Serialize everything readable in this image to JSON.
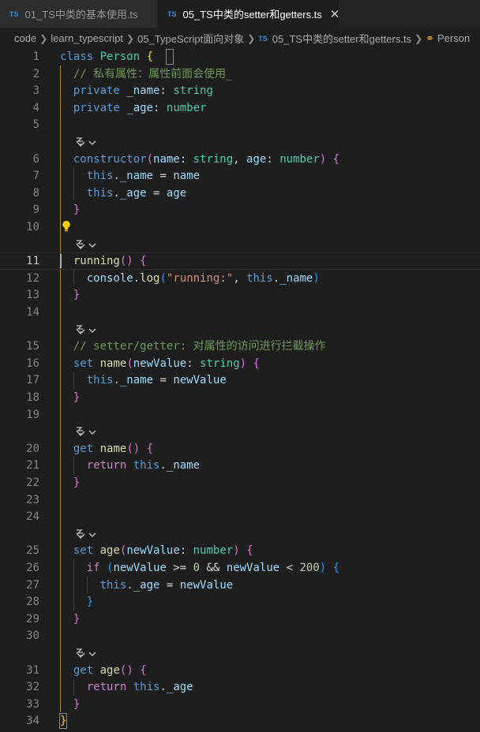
{
  "tabs": [
    {
      "icon": "TS",
      "label": "01_TS中类的基本使用.ts",
      "active": false
    },
    {
      "icon": "TS",
      "label": "05_TS中类的setter和getters.ts",
      "active": true,
      "close": "✕"
    }
  ],
  "breadcrumb": {
    "items": [
      "code",
      "learn_typescript",
      "05_TypeScript面向对象"
    ],
    "file_badge": "TS",
    "file": "05_TS中类的setter和getters.ts",
    "symbol": "Person"
  },
  "lightbulb_icon": "lightbulb-icon",
  "codelens_icon": "copilot-sparkle-icon",
  "line_numbers": [
    "1",
    "2",
    "3",
    "4",
    "5",
    "6",
    "7",
    "8",
    "9",
    "10",
    "11",
    "12",
    "13",
    "14",
    "15",
    "16",
    "17",
    "18",
    "19",
    "20",
    "21",
    "22",
    "23",
    "24",
    "25",
    "26",
    "27",
    "28",
    "29",
    "30",
    "31",
    "32",
    "33",
    "34"
  ],
  "current_line": "11",
  "colors": {
    "keyword": "#569cd6",
    "class": "#4ec9b0",
    "comment": "#6a9955",
    "function": "#dcdcaa",
    "property": "#9cdcfe",
    "string": "#ce9178",
    "number": "#b5cea8",
    "control": "#c586c0",
    "bracket1": "#ffd700",
    "bracket2": "#da70d6",
    "bracket3": "#179fff"
  },
  "code": [
    [
      [
        "class",
        "kw"
      ],
      [
        " ",
        "pu"
      ],
      [
        "Person",
        "cl"
      ],
      [
        " ",
        "pu"
      ],
      [
        "{",
        "b1"
      ]
    ],
    [
      [
        "  ",
        "pu"
      ],
      [
        "// 私有属性：属性前面会使用_",
        "cm"
      ]
    ],
    [
      [
        "  ",
        "pu"
      ],
      [
        "private",
        "kw"
      ],
      [
        " ",
        "pu"
      ],
      [
        "_name",
        "pr"
      ],
      [
        ": ",
        "pu"
      ],
      [
        "string",
        "cl"
      ]
    ],
    [
      [
        "  ",
        "pu"
      ],
      [
        "private",
        "kw"
      ],
      [
        " ",
        "pu"
      ],
      [
        "_age",
        "pr"
      ],
      [
        ": ",
        "pu"
      ],
      [
        "number",
        "cl"
      ]
    ],
    [],
    [
      [
        "  ",
        "pu"
      ],
      [
        "constructor",
        "kw"
      ],
      [
        "(",
        "b2"
      ],
      [
        "name",
        "pr"
      ],
      [
        ": ",
        "pu"
      ],
      [
        "string",
        "cl"
      ],
      [
        ", ",
        "pu"
      ],
      [
        "age",
        "pr"
      ],
      [
        ": ",
        "pu"
      ],
      [
        "number",
        "cl"
      ],
      [
        ")",
        "b2"
      ],
      [
        " ",
        "pu"
      ],
      [
        "{",
        "b2"
      ]
    ],
    [
      [
        "    ",
        "pu"
      ],
      [
        "this",
        "kw"
      ],
      [
        ".",
        "pu"
      ],
      [
        "_name",
        "pr"
      ],
      [
        " = ",
        "pu"
      ],
      [
        "name",
        "pr"
      ]
    ],
    [
      [
        "    ",
        "pu"
      ],
      [
        "this",
        "kw"
      ],
      [
        ".",
        "pu"
      ],
      [
        "_age",
        "pr"
      ],
      [
        " = ",
        "pu"
      ],
      [
        "age",
        "pr"
      ]
    ],
    [
      [
        "  ",
        "pu"
      ],
      [
        "}",
        "b2"
      ]
    ],
    [],
    [
      [
        "  ",
        "pu"
      ],
      [
        "running",
        "fn"
      ],
      [
        "()",
        "b2"
      ],
      [
        " ",
        "pu"
      ],
      [
        "{",
        "b2"
      ]
    ],
    [
      [
        "    ",
        "pu"
      ],
      [
        "console",
        "pr"
      ],
      [
        ".",
        "pu"
      ],
      [
        "log",
        "fn"
      ],
      [
        "(",
        "b3"
      ],
      [
        "\"running:\"",
        "st"
      ],
      [
        ", ",
        "pu"
      ],
      [
        "this",
        "kw"
      ],
      [
        ".",
        "pu"
      ],
      [
        "_name",
        "pr"
      ],
      [
        ")",
        "b3"
      ]
    ],
    [
      [
        "  ",
        "pu"
      ],
      [
        "}",
        "b2"
      ]
    ],
    [],
    [
      [
        "  ",
        "pu"
      ],
      [
        "// setter/getter: 对属性的访问进行拦截操作",
        "cm"
      ]
    ],
    [
      [
        "  ",
        "pu"
      ],
      [
        "set",
        "kw"
      ],
      [
        " ",
        "pu"
      ],
      [
        "name",
        "fn"
      ],
      [
        "(",
        "b2"
      ],
      [
        "newValue",
        "pr"
      ],
      [
        ": ",
        "pu"
      ],
      [
        "string",
        "cl"
      ],
      [
        ")",
        "b2"
      ],
      [
        " ",
        "pu"
      ],
      [
        "{",
        "b2"
      ]
    ],
    [
      [
        "    ",
        "pu"
      ],
      [
        "this",
        "kw"
      ],
      [
        ".",
        "pu"
      ],
      [
        "_name",
        "pr"
      ],
      [
        " = ",
        "pu"
      ],
      [
        "newValue",
        "pr"
      ]
    ],
    [
      [
        "  ",
        "pu"
      ],
      [
        "}",
        "b2"
      ]
    ],
    [],
    [
      [
        "  ",
        "pu"
      ],
      [
        "get",
        "kw"
      ],
      [
        " ",
        "pu"
      ],
      [
        "name",
        "fn"
      ],
      [
        "()",
        "b2"
      ],
      [
        " ",
        "pu"
      ],
      [
        "{",
        "b2"
      ]
    ],
    [
      [
        "    ",
        "pu"
      ],
      [
        "return",
        "cf"
      ],
      [
        " ",
        "pu"
      ],
      [
        "this",
        "kw"
      ],
      [
        ".",
        "pu"
      ],
      [
        "_name",
        "pr"
      ]
    ],
    [
      [
        "  ",
        "pu"
      ],
      [
        "}",
        "b2"
      ]
    ],
    [],
    [],
    [
      [
        "  ",
        "pu"
      ],
      [
        "set",
        "kw"
      ],
      [
        " ",
        "pu"
      ],
      [
        "age",
        "fn"
      ],
      [
        "(",
        "b2"
      ],
      [
        "newValue",
        "pr"
      ],
      [
        ": ",
        "pu"
      ],
      [
        "number",
        "cl"
      ],
      [
        ")",
        "b2"
      ],
      [
        " ",
        "pu"
      ],
      [
        "{",
        "b2"
      ]
    ],
    [
      [
        "    ",
        "pu"
      ],
      [
        "if",
        "cf"
      ],
      [
        " ",
        "pu"
      ],
      [
        "(",
        "b3"
      ],
      [
        "newValue",
        "pr"
      ],
      [
        " >= ",
        "pu"
      ],
      [
        "0",
        "nu"
      ],
      [
        " && ",
        "pu"
      ],
      [
        "newValue",
        "pr"
      ],
      [
        " < ",
        "pu"
      ],
      [
        "200",
        "nu"
      ],
      [
        ")",
        "b3"
      ],
      [
        " ",
        "pu"
      ],
      [
        "{",
        "b3"
      ]
    ],
    [
      [
        "      ",
        "pu"
      ],
      [
        "this",
        "kw"
      ],
      [
        ".",
        "pu"
      ],
      [
        "_age",
        "pr"
      ],
      [
        " = ",
        "pu"
      ],
      [
        "newValue",
        "pr"
      ]
    ],
    [
      [
        "    ",
        "pu"
      ],
      [
        "}",
        "b3"
      ]
    ],
    [
      [
        "  ",
        "pu"
      ],
      [
        "}",
        "b2"
      ]
    ],
    [],
    [
      [
        "  ",
        "pu"
      ],
      [
        "get",
        "kw"
      ],
      [
        " ",
        "pu"
      ],
      [
        "age",
        "fn"
      ],
      [
        "()",
        "b2"
      ],
      [
        " ",
        "pu"
      ],
      [
        "{",
        "b2"
      ]
    ],
    [
      [
        "    ",
        "pu"
      ],
      [
        "return",
        "cf"
      ],
      [
        " ",
        "pu"
      ],
      [
        "this",
        "kw"
      ],
      [
        ".",
        "pu"
      ],
      [
        "_age",
        "pr"
      ]
    ],
    [
      [
        "  ",
        "pu"
      ],
      [
        "}",
        "b2"
      ]
    ],
    [
      [
        "}",
        "b1"
      ]
    ]
  ]
}
